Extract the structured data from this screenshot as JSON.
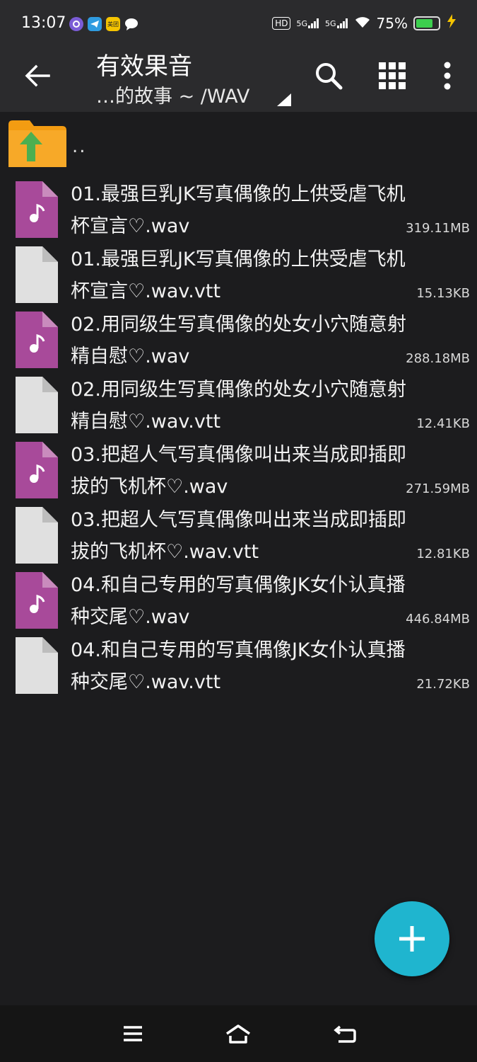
{
  "status": {
    "time": "13:07",
    "hd": "HD",
    "net1": "5G",
    "net2": "5G",
    "battery_text": "75%",
    "battery_level": 0.75,
    "app_icons": [
      "app-icon-purple",
      "telegram-icon",
      "meituan-icon",
      "chat-bubble-icon"
    ],
    "meituan_label": "美团"
  },
  "toolbar": {
    "title": "有效果音",
    "subtitle": "…的故事 ~ /WAV",
    "icons": [
      "back-arrow-icon",
      "search-icon",
      "grid-view-icon",
      "more-vert-icon"
    ]
  },
  "parent": {
    "label": ".."
  },
  "files": [
    {
      "name": "01.最强巨乳JK写真偶像的上供受虐飞机杯宣言♡.wav",
      "size": "319.11MB",
      "type": "audio"
    },
    {
      "name": "01.最强巨乳JK写真偶像的上供受虐飞机杯宣言♡.wav.vtt",
      "size": "15.13KB",
      "type": "text"
    },
    {
      "name": "02.用同级生写真偶像的处女小穴随意射精自慰♡.wav",
      "size": "288.18MB",
      "type": "audio"
    },
    {
      "name": "02.用同级生写真偶像的处女小穴随意射精自慰♡.wav.vtt",
      "size": "12.41KB",
      "type": "text"
    },
    {
      "name": "03.把超人气写真偶像叫出来当成即插即拔的飞机杯♡.wav",
      "size": "271.59MB",
      "type": "audio"
    },
    {
      "name": "03.把超人气写真偶像叫出来当成即插即拔的飞机杯♡.wav.vtt",
      "size": "12.81KB",
      "type": "text"
    },
    {
      "name": "04.和自己专用的写真偶像JK女仆认真播种交尾♡.wav",
      "size": "446.84MB",
      "type": "audio"
    },
    {
      "name": "04.和自己专用的写真偶像JK女仆认真播种交尾♡.wav.vtt",
      "size": "21.72KB",
      "type": "text"
    }
  ],
  "colors": {
    "audio_file": "#a84a9a",
    "text_file": "#e0e0e0",
    "fab": "#1fb5cf",
    "folder": "#f39c12",
    "folder_arrow": "#4caf50"
  },
  "fab": {
    "icon": "plus-icon"
  },
  "navbar": {
    "icons": [
      "menu-icon",
      "home-icon",
      "back-icon"
    ]
  }
}
